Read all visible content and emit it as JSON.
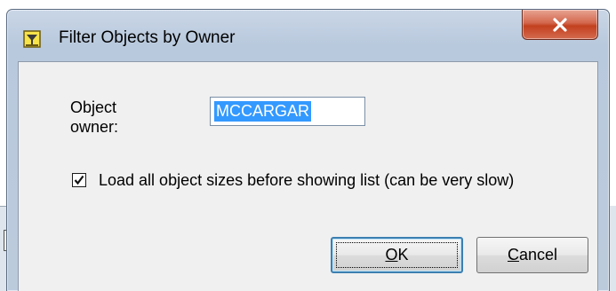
{
  "dialog": {
    "title": "Filter Objects by Owner",
    "close_label": "x",
    "icon": "filter-app-icon"
  },
  "form": {
    "owner_label": "Object\nowner:",
    "owner_value": "MCCARGAR",
    "load_sizes_checked": true,
    "load_sizes_label": "Load all object sizes before showing list (can be very slow)"
  },
  "buttons": {
    "ok_accel": "O",
    "ok_rest": "K",
    "cancel_accel": "C",
    "cancel_rest": "ancel"
  },
  "colors": {
    "accent": "#3399ff",
    "close_button": "#c2401f",
    "frame": "#bccbdc"
  }
}
